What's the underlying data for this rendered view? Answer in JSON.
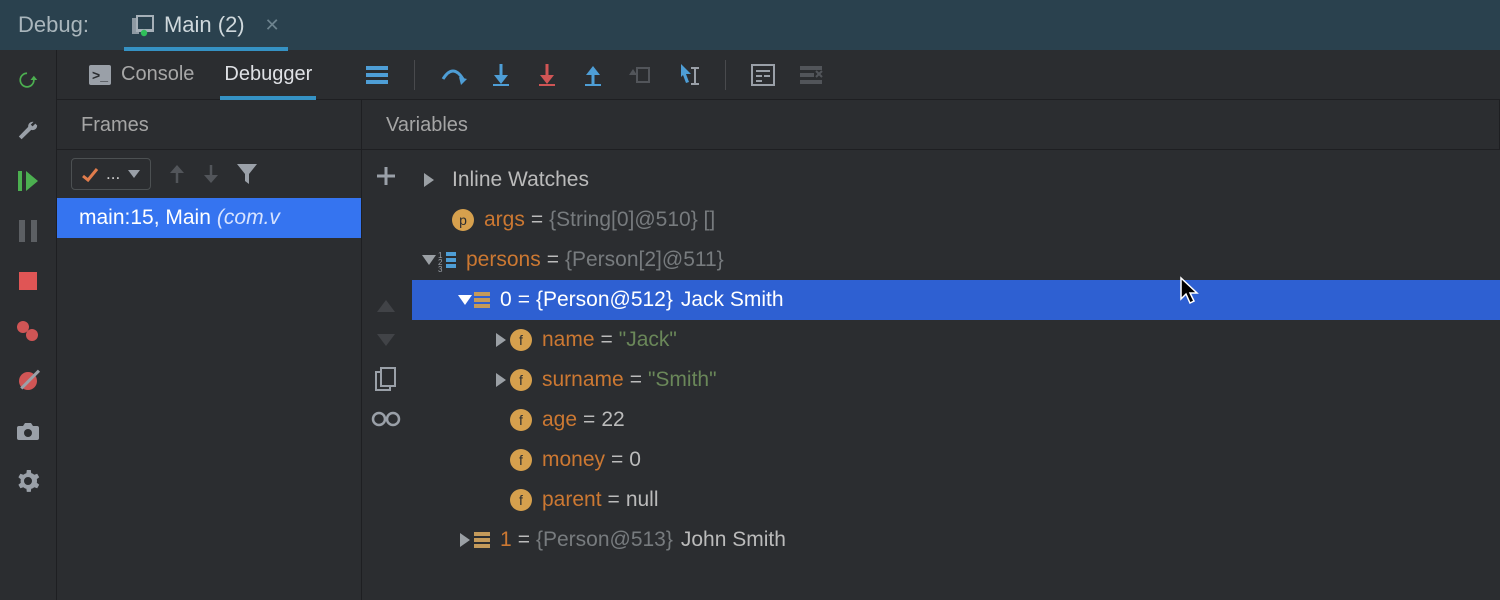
{
  "header": {
    "panel_label": "Debug:",
    "tab_label": "Main (2)"
  },
  "toolbar": {
    "console_label": "Console",
    "debugger_label": "Debugger"
  },
  "panels": {
    "frames_title": "Frames",
    "variables_title": "Variables"
  },
  "frames": {
    "thread_selector": "...",
    "item": {
      "text_prefix": "main:15, Main",
      "pkg": "(com.v"
    }
  },
  "vars": {
    "inline_watches": "Inline Watches",
    "args": {
      "name": "args",
      "value": "{String[0]@510} []"
    },
    "persons": {
      "name": "persons",
      "value": "{Person[2]@511}"
    },
    "person0": {
      "index": "0",
      "obj": "{Person@512}",
      "tail": "Jack Smith"
    },
    "name": {
      "name": "name",
      "value": "\"Jack\""
    },
    "surname": {
      "name": "surname",
      "value": "\"Smith\""
    },
    "age": {
      "name": "age",
      "value": "22"
    },
    "money": {
      "name": "money",
      "value": "0"
    },
    "parent": {
      "name": "parent",
      "value": "null"
    },
    "person1": {
      "index": "1",
      "obj": "{Person@513}",
      "tail": "John Smith"
    }
  }
}
